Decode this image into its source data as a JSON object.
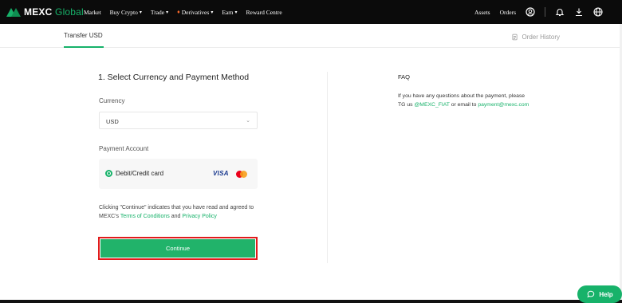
{
  "header": {
    "logo_main": "MEXC",
    "logo_sub": "Global",
    "nav": [
      {
        "label": "Market",
        "dropdown": false
      },
      {
        "label": "Buy Crypto",
        "dropdown": true
      },
      {
        "label": "Trade",
        "dropdown": true
      },
      {
        "label": "Derivatives",
        "dropdown": true
      },
      {
        "label": "Earn",
        "dropdown": true
      },
      {
        "label": "Reward Centre",
        "dropdown": false
      }
    ],
    "assets_label": "Assets",
    "orders_label": "Orders"
  },
  "subheader": {
    "tab_label": "Transfer USD",
    "order_history_label": "Order History"
  },
  "form": {
    "title": "1. Select Currency and Payment Method",
    "currency_label": "Currency",
    "currency_value": "USD",
    "payment_account_label": "Payment Account",
    "payment_method_label": "Debit/Credit card",
    "visa_label": "VISA",
    "agree_text_1": "Clicking \"Continue\" indicates that you have read and agreed to MEXC's",
    "terms_label": "Terms of Conditions",
    "and_text": "and",
    "privacy_label": "Privacy Policy",
    "continue_label": "Continue"
  },
  "faq": {
    "title": "FAQ",
    "text_1": "If you have any questions about the payment, please TG us",
    "tg_handle": "@MEXC_FIAT",
    "text_2": "or email to",
    "email": "payment@mexc.com"
  },
  "help_label": "Help",
  "colors": {
    "accent": "#17b26a",
    "highlight_border": "#e11b1b",
    "topbar": "#0b0b0b"
  }
}
